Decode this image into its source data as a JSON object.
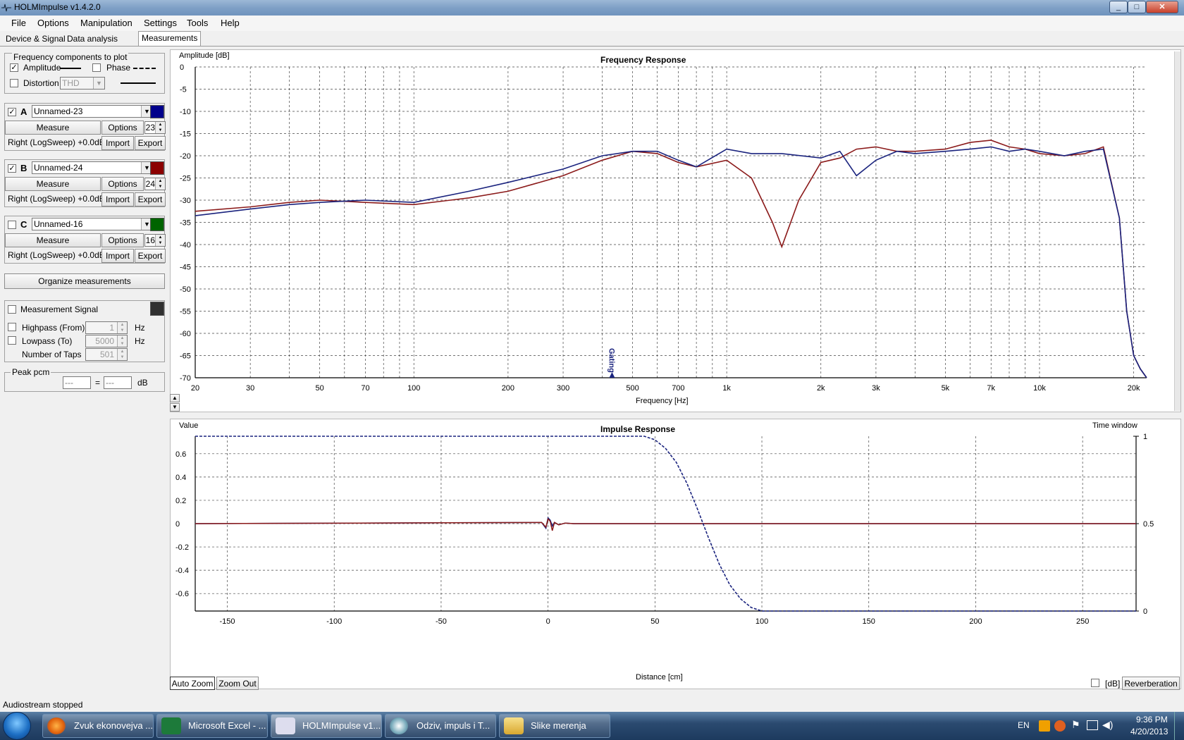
{
  "window": {
    "title": "HOLMImpulse  v1.4.2.0"
  },
  "menu": [
    "File",
    "Options",
    "Manipulation",
    "Settings",
    "Tools",
    "Help"
  ],
  "tabs": [
    "Device & Signal",
    "Data analysis",
    "Measurements"
  ],
  "freq_components": {
    "title": "Frequency components to plot",
    "amplitude_label": "Amplitude",
    "amplitude_checked": true,
    "phase_label": "Phase",
    "phase_checked": false,
    "distortion_label": "Distortion",
    "distortion_checked": false,
    "distortion_value": "THD"
  },
  "measurements": [
    {
      "letter": "A",
      "checked": true,
      "name": "Unnamed-23",
      "color": "#00008b",
      "measure": "Measure",
      "options": "Options",
      "number": "23",
      "source": "Right (LogSweep) +0.0dB",
      "import": "Import",
      "export": "Export"
    },
    {
      "letter": "B",
      "checked": true,
      "name": "Unnamed-24",
      "color": "#8b0000",
      "measure": "Measure",
      "options": "Options",
      "number": "24",
      "source": "Right (LogSweep) +0.0dB",
      "import": "Import",
      "export": "Export"
    },
    {
      "letter": "C",
      "checked": false,
      "name": "Unnamed-16",
      "color": "#006400",
      "measure": "Measure",
      "options": "Options",
      "number": "16",
      "source": "Right (LogSweep) +0.0dB",
      "import": "Import",
      "export": "Export"
    }
  ],
  "organize_label": "Organize measurements",
  "signal": {
    "label": "Measurement Signal",
    "checked": false,
    "color": "#303030",
    "highpass_label": "Highpass (From)",
    "highpass_value": "1",
    "highpass_unit": "Hz",
    "lowpass_label": "Lowpass (To)",
    "lowpass_value": "5000",
    "lowpass_unit": "Hz",
    "taps_label": "Number of Taps",
    "taps_value": "501"
  },
  "peak": {
    "title": "Peak pcm",
    "left": "---",
    "equals": "=",
    "right": "---",
    "unit": "dB"
  },
  "freq_plot": {
    "title": "Frequency Response",
    "ylabel": "Amplitude [dB]",
    "xlabel": "Frequency [Hz]",
    "y_ticks": [
      "0",
      "-5",
      "-10",
      "-15",
      "-20",
      "-25",
      "-30",
      "-35",
      "-40",
      "-45",
      "-50",
      "-55",
      "-60",
      "-65",
      "-70"
    ],
    "x_ticks": [
      {
        "f": 20,
        "label": "20"
      },
      {
        "f": 30,
        "label": "30"
      },
      {
        "f": 50,
        "label": "50"
      },
      {
        "f": 70,
        "label": "70"
      },
      {
        "f": 100,
        "label": "100"
      },
      {
        "f": 200,
        "label": "200"
      },
      {
        "f": 300,
        "label": "300"
      },
      {
        "f": 500,
        "label": "500"
      },
      {
        "f": 700,
        "label": "700"
      },
      {
        "f": 1000,
        "label": "1k"
      },
      {
        "f": 2000,
        "label": "2k"
      },
      {
        "f": 3000,
        "label": "3k"
      },
      {
        "f": 5000,
        "label": "5k"
      },
      {
        "f": 7000,
        "label": "7k"
      },
      {
        "f": 10000,
        "label": "10k"
      },
      {
        "f": 20000,
        "label": "20k"
      }
    ],
    "gating_label": "Gating",
    "gating_freq": 430
  },
  "impulse_plot": {
    "title": "Impulse Response",
    "ylabel": "Value",
    "right_label": "Time window",
    "xlabel": "Distance [cm]",
    "y_ticks": [
      "0.6",
      "0.4",
      "0.2",
      "0",
      "-0.2",
      "-0.4",
      "-0.6"
    ],
    "x_ticks": [
      "-150",
      "-100",
      "-50",
      "0",
      "50",
      "100",
      "150",
      "200",
      "250"
    ],
    "right_ticks": [
      "1",
      "0.5",
      "0"
    ]
  },
  "chart_data": [
    {
      "type": "line",
      "title": "Frequency Response",
      "xlabel": "Frequency [Hz]",
      "ylabel": "Amplitude [dB]",
      "xscale": "log",
      "xlim": [
        20,
        22000
      ],
      "ylim": [
        -70,
        0
      ],
      "grid": true,
      "series": [
        {
          "name": "A",
          "color": "#1a237e",
          "x": [
            20,
            30,
            40,
            50,
            70,
            100,
            150,
            200,
            300,
            400,
            500,
            600,
            700,
            800,
            1000,
            1200,
            1500,
            2000,
            2300,
            2600,
            3000,
            3500,
            4000,
            5000,
            6000,
            7000,
            8000,
            9000,
            10000,
            12000,
            14000,
            16000,
            18000,
            19000,
            20000,
            21000,
            22000
          ],
          "y": [
            -33.5,
            -32,
            -31,
            -30.5,
            -30,
            -30.5,
            -28,
            -26,
            -23,
            -20,
            -19,
            -19,
            -21,
            -22.5,
            -18.5,
            -19.5,
            -19.5,
            -20.5,
            -19,
            -24.5,
            -21,
            -19,
            -19.5,
            -19,
            -18.5,
            -18,
            -19,
            -18.5,
            -19,
            -20,
            -19,
            -18.5,
            -34,
            -55,
            -65,
            -68,
            -70
          ]
        },
        {
          "name": "B",
          "color": "#8b1a1a",
          "x": [
            20,
            30,
            40,
            50,
            70,
            100,
            150,
            200,
            300,
            400,
            500,
            600,
            700,
            800,
            1000,
            1200,
            1400,
            1500,
            1700,
            2000,
            2300,
            2600,
            3000,
            3500,
            4000,
            5000,
            6000,
            7000,
            8000,
            9000,
            10000,
            12000,
            14000,
            16000,
            18000,
            19000,
            20000,
            21000,
            22000
          ],
          "y": [
            -32.5,
            -31.5,
            -30.5,
            -30,
            -30.5,
            -31,
            -29.5,
            -28,
            -24.5,
            -21,
            -19,
            -19.5,
            -21.5,
            -22.5,
            -21,
            -25,
            -35,
            -40.5,
            -30,
            -21.5,
            -20.5,
            -18.5,
            -18,
            -19,
            -19,
            -18.5,
            -17,
            -16.5,
            -18,
            -18.5,
            -19.5,
            -20,
            -19.5,
            -18,
            -34,
            -55,
            -65,
            -68,
            -70
          ]
        }
      ]
    },
    {
      "type": "line",
      "title": "Impulse Response",
      "xlabel": "Distance [cm]",
      "ylabel": "Value",
      "xlim": [
        -165,
        275
      ],
      "ylim": [
        -0.75,
        0.75
      ],
      "grid": true,
      "series": [
        {
          "name": "A",
          "color": "#1a237e",
          "x": [
            -165,
            -3,
            -1,
            0,
            1,
            2,
            3,
            5,
            8,
            12,
            20,
            275
          ],
          "y": [
            0,
            0.01,
            -0.04,
            0.05,
            0.03,
            -0.02,
            0.01,
            -0.01,
            0.005,
            0,
            0,
            0
          ]
        },
        {
          "name": "B",
          "color": "#8b1a1a",
          "x": [
            -165,
            -3,
            -1,
            0,
            1,
            2,
            3,
            5,
            8,
            12,
            20,
            40,
            100,
            110,
            112,
            275
          ],
          "y": [
            0,
            0.01,
            -0.03,
            0.04,
            0.02,
            -0.06,
            0.01,
            -0.01,
            0.005,
            0,
            0,
            0,
            0,
            0,
            0,
            0
          ]
        },
        {
          "name": "Time window",
          "color": "#1a237e",
          "dashed": true,
          "x": [
            -165,
            45,
            50,
            55,
            60,
            65,
            70,
            75,
            80,
            85,
            90,
            95,
            100,
            275
          ],
          "y": [
            1,
            1,
            0.98,
            0.93,
            0.85,
            0.73,
            0.58,
            0.42,
            0.27,
            0.15,
            0.07,
            0.02,
            0,
            0
          ]
        }
      ]
    }
  ],
  "zoom": {
    "auto": "Auto Zoom",
    "out": "Zoom Out"
  },
  "db_label": "[dB]",
  "reverberation": "Reverberation",
  "status": "Audiostream stopped",
  "taskbar": {
    "items": [
      "Zvuk ekonovejva ...",
      "Microsoft Excel - ...",
      "HOLMImpulse  v1...",
      "Odziv, impuls i T...",
      "Slike merenja"
    ],
    "lang": "EN",
    "time": "9:36 PM",
    "date": "4/20/2013"
  }
}
